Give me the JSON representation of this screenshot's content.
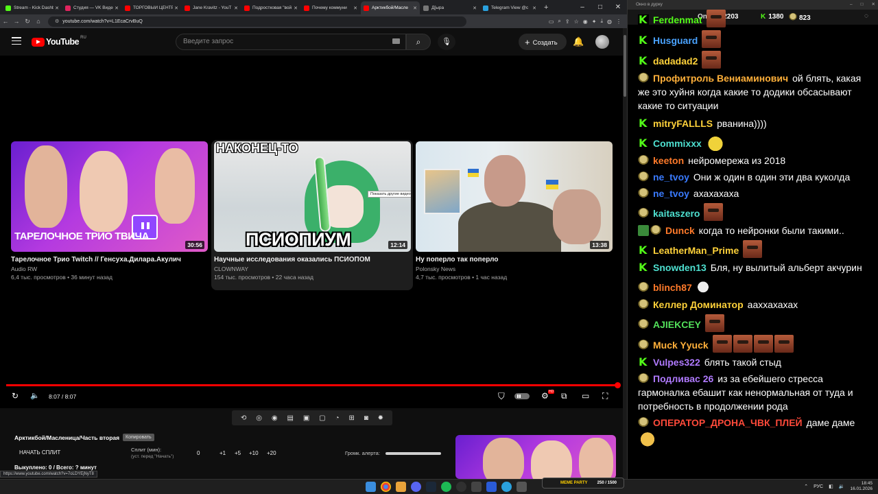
{
  "browser": {
    "tabs": [
      {
        "label": "Stream - Kick Dashb",
        "fav": "#53fc18"
      },
      {
        "label": "Студия — VK Видео",
        "fav": "#e0245e"
      },
      {
        "label": "ТОРГОВЫЙ ЦЕНТР",
        "fav": "#ff0000"
      },
      {
        "label": "Jane Kravitz - YouT",
        "fav": "#ff0000"
      },
      {
        "label": "Подростковая \"вой",
        "fav": "#ff0000"
      },
      {
        "label": "Почему коммуни",
        "fav": "#ff0000"
      },
      {
        "label": "Арктикбой/Масле",
        "fav": "#ff0000",
        "active": true
      },
      {
        "label": "Д[ыра",
        "fav": "#777777"
      },
      {
        "label": "Telegram View @c",
        "fav": "#2aa1de"
      }
    ],
    "url": "youtube.com/watch?v=L1EcaCrvBuQ"
  },
  "youtube": {
    "logo_text": "YouTube",
    "region": "RU",
    "search_placeholder": "Введите запрос",
    "create_label": "Создать"
  },
  "endscreen": {
    "videos": [
      {
        "title": "Тарелочное Трио Twitch // Генсуха.Дилара.Акулич",
        "channel": "Audio RW",
        "meta": "6,4 тыс. просмотров • 36 минут назад",
        "duration": "30:56",
        "thumb_caption": "ТАРЕЛОЧНОЕ ТРИО ТВИЧА"
      },
      {
        "title": "Научные исследования оказались ПСИОПОМ",
        "channel": "CLOWNWAY",
        "meta": "154 тыс. просмотров • 22 часа назад",
        "duration": "12:14",
        "thumb_top": "НАКОНЕЦ-ТО",
        "thumb_bottom": "ПСИОПИУМ",
        "tooltip": "Показать другие видео (v)"
      },
      {
        "title": "Ну поперло так поперло",
        "channel": "Polonsky News",
        "meta": "4,7 тыс. просмотров • 1 час назад",
        "duration": "13:38"
      }
    ]
  },
  "player": {
    "time": "8:07 / 8:07",
    "progress": 1.0,
    "hd_badge": "HD"
  },
  "extension": {
    "title": "Арктикбой/Масленица/Часть вторая",
    "copy_label": "Копировать",
    "start_split": "НАЧАТЬ СПЛИТ",
    "split_label": "Сплит (мин):",
    "split_hint": "(уст. перед \"Начать\")",
    "split_values": [
      "0",
      "+1",
      "+5",
      "+10",
      "+20"
    ],
    "alert_label": "Громк. алерта:",
    "alert_volume": 1.0,
    "bought": "Выкуплено: 0 / Всего: ? минут"
  },
  "status_url": "https://www.youtube.com/watch?v=7oLDYEjNyT8",
  "chat": {
    "window_title": "Окно в дурку",
    "online_label": "Online:",
    "online_count": "2203",
    "kick_count": "1380",
    "other_count": "823",
    "messages": [
      {
        "badge": "kick",
        "nick": "Ferdenmat",
        "color": "#53fc18",
        "text": "",
        "emotes": [
          "face"
        ]
      },
      {
        "badge": "kick",
        "nick": "Husguard",
        "color": "#4aa3ff",
        "text": "",
        "emotes": [
          "face"
        ]
      },
      {
        "badge": "kick",
        "nick": "dadadad2",
        "color": "#ffd23a",
        "text": "",
        "emotes": [
          "face"
        ]
      },
      {
        "badge": "bird",
        "nick": "Профитроль Вениаминович",
        "color": "#ffb03a",
        "text": "ой блять, какая же это хуйня когда какие то додики обсасывают какие то ситуации",
        "emotes": []
      },
      {
        "badge": "kick",
        "nick": "mitryFALLLS",
        "color": "#ffd23a",
        "text": "рванина))))",
        "emotes": []
      },
      {
        "badge": "kick",
        "nick": "Commixxx",
        "color": "#4ee0d0",
        "text": "",
        "emotes": [
          "banana"
        ]
      },
      {
        "badge": "bird",
        "nick": "keeton",
        "color": "#ff7a2a",
        "text": "нейромережа из  2018",
        "emotes": []
      },
      {
        "badge": "bird",
        "nick": "ne_tvoy",
        "color": "#3a7bff",
        "text": "Они ж один в один эти два куколда",
        "emotes": []
      },
      {
        "badge": "bird",
        "nick": "ne_tvoy",
        "color": "#3a7bff",
        "text": "ахахахаха",
        "emotes": []
      },
      {
        "badge": "bird",
        "nick": "kaitaszero",
        "color": "#4ee0d0",
        "text": "",
        "emotes": [
          "face"
        ]
      },
      {
        "badge": "gbird",
        "nick": "Dunck",
        "color": "#ff7a2a",
        "text": "когда то нейронки были такими..",
        "emotes": []
      },
      {
        "badge": "kick",
        "nick": "LeatherMan_Prime",
        "color": "#ffd23a",
        "text": "",
        "emotes": [
          "face"
        ]
      },
      {
        "badge": "kick",
        "nick": "Snowden13",
        "color": "#4ee0d0",
        "text": "Бля, ну вылитый альберт акчурин",
        "emotes": []
      },
      {
        "badge": "bird",
        "nick": "blinch87",
        "color": "#ff7a2a",
        "text": "",
        "emotes": [
          "cat"
        ]
      },
      {
        "badge": "bird",
        "nick": "Келлер Доминатор",
        "color": "#ffd23a",
        "text": "ааххахахах",
        "emotes": []
      },
      {
        "badge": "bird",
        "nick": "AJIEKCEY",
        "color": "#53e05a",
        "text": "",
        "emotes": [
          "face"
        ]
      },
      {
        "badge": "bird",
        "nick": "Muck Yyuck",
        "color": "#ffb03a",
        "text": "",
        "emotes": [
          "face",
          "face",
          "face",
          "face"
        ]
      },
      {
        "badge": "kick",
        "nick": "Vulpes322",
        "color": "#b07aff",
        "text": "блять такой стыд",
        "emotes": []
      },
      {
        "badge": "bird",
        "nick": "Подливас 26",
        "color": "#b07aff",
        "text": "из за ебейшего стресса гармоналка ебашит как ненормальная от туда и потребность в продолжении рода",
        "emotes": []
      },
      {
        "badge": "bird",
        "nick": "ОПЕРАТОР_ДРОНА_ЧВК_ПЛЕЙ",
        "color": "#ff4a3a",
        "text": "даме даме",
        "emotes": [
          "face2"
        ]
      }
    ]
  },
  "taskbar": {
    "lang": "РУС",
    "time": "18:45",
    "date": "16.01.2026",
    "meme_party": "MEME PARTY",
    "meme_count": "250 / 1500"
  }
}
